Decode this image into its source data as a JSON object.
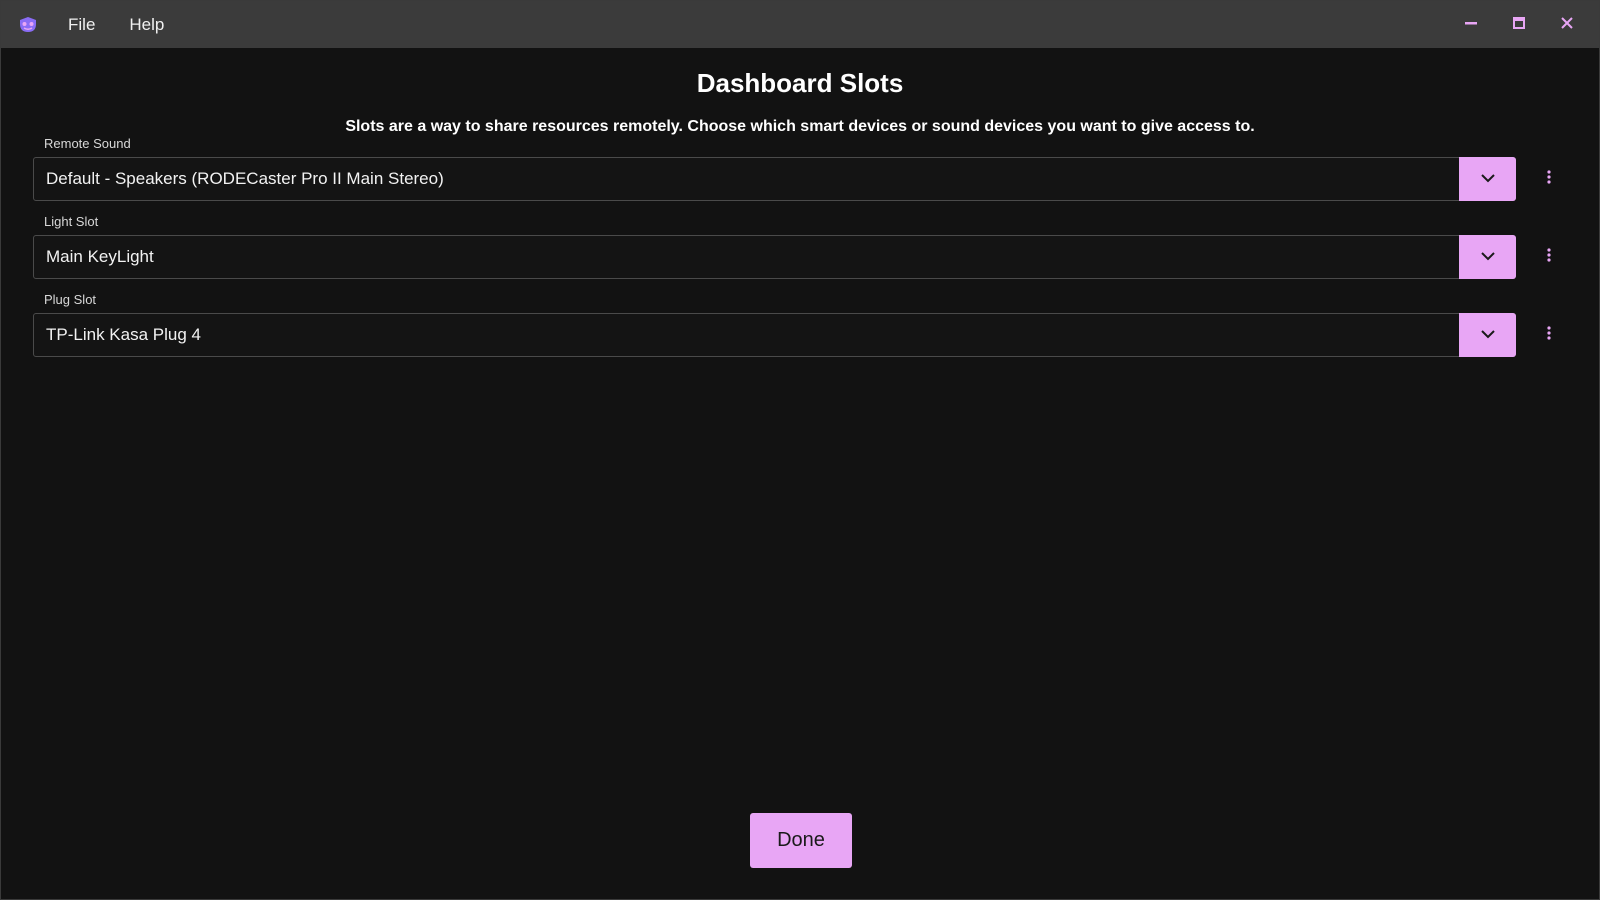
{
  "menu": {
    "file": "File",
    "help": "Help"
  },
  "page": {
    "title": "Dashboard Slots",
    "subtitle": "Slots are a way to share resources remotely. Choose which smart devices or sound devices you want to give access to."
  },
  "slots": [
    {
      "label": "Remote Sound",
      "value": "Default - Speakers (RODECaster Pro II Main Stereo)"
    },
    {
      "label": "Light Slot",
      "value": "Main KeyLight"
    },
    {
      "label": "Plug Slot",
      "value": "TP-Link Kasa Plug 4"
    }
  ],
  "done_label": "Done",
  "colors": {
    "accent": "#e8a6f5",
    "background": "#121212",
    "titlebar": "#3b3b3b",
    "logo": "#8a6cf5"
  },
  "icons": {
    "logo": "app-logo-icon",
    "minimize": "minimize-icon",
    "maximize": "maximize-icon",
    "close": "close-icon",
    "chevron": "chevron-down-icon",
    "kebab": "more-vertical-icon"
  }
}
